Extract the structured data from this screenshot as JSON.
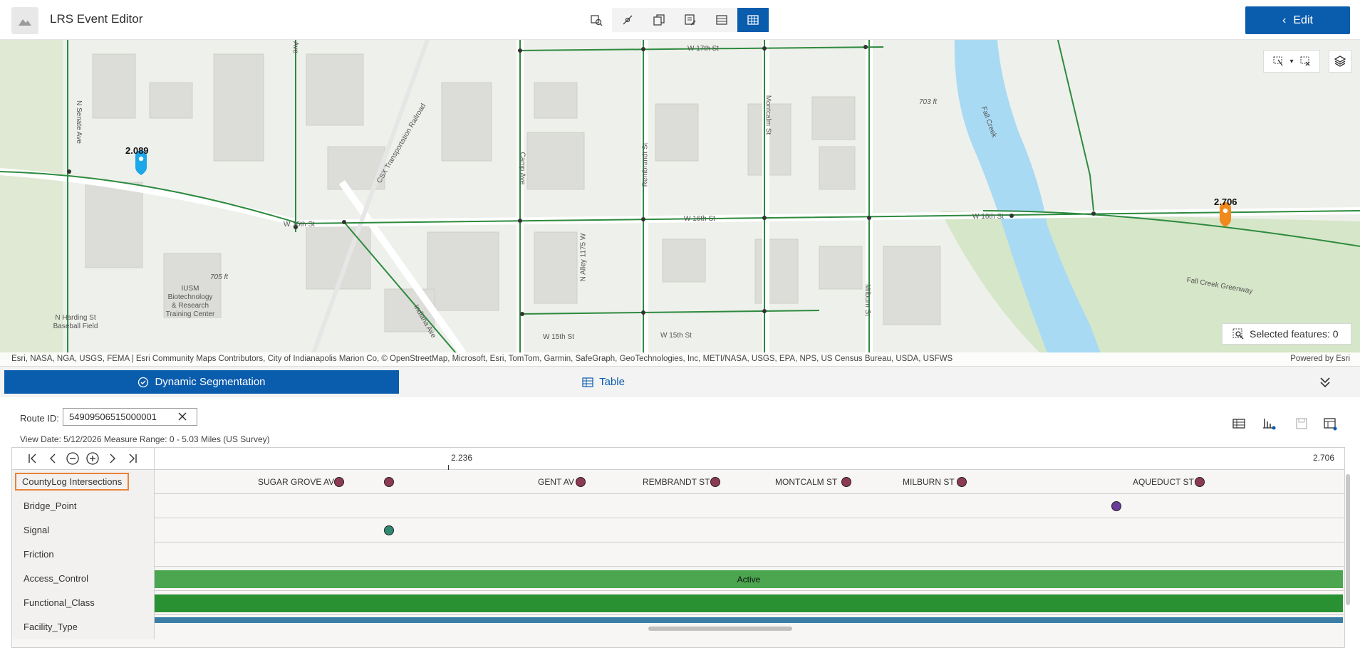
{
  "app": {
    "title": "LRS Event Editor",
    "edit_label": "Edit"
  },
  "toolbar": {
    "icons": [
      "identify-route-icon",
      "locate-measure-icon",
      "copy-events-icon",
      "edit-events-icon",
      "table-icon",
      "grid-table-icon"
    ],
    "active": "grid-table-icon"
  },
  "map": {
    "street_labels": [
      "W 17th St",
      "W 16th St",
      "W 16th St",
      "W 16th St",
      "W 15th St",
      "W 15th St",
      "Indiana Ave",
      "CSX Transportation Railroad",
      "N Senate Ave",
      "Camp Ave",
      "Rembrandt St",
      "N Alley 1175 W",
      "Montcalm St",
      "Milburn St",
      "Fall Creek",
      "Fall Creek Greenway",
      "Ave"
    ],
    "poi_labels": {
      "iusm": "IUSM Biotechnology & Research Training Center",
      "harding": "N Harding St Baseball Field",
      "elev1": "705 ft",
      "elev2": "703 ft"
    },
    "pins": [
      {
        "label": "2.089",
        "color": "#1ba7e8"
      },
      {
        "label": "2.706",
        "color": "#f08a1c"
      }
    ],
    "selected_features": "Selected features: 0",
    "attribution": "Esri, NASA, NGA, USGS, FEMA | Esri Community Maps Contributors, City of Indianapolis Marion Co, © OpenStreetMap, Microsoft, Esri, TomTom, Garmin, SafeGraph, GeoTechnologies, Inc, METI/NASA, USGS, EPA, NPS, US Census Bureau, USDA, USFWS",
    "powered_by": "Powered by Esri"
  },
  "tabs": {
    "dynamic_segmentation": "Dynamic Segmentation",
    "table": "Table"
  },
  "dynseg": {
    "route_label": "Route ID:",
    "route_value": "54909506515000001",
    "view_info": "View Date: 5/12/2026   Measure Range: 0 - 5.03 Miles (US Survey)",
    "ruler": {
      "left": "2.236",
      "right": "2.706"
    },
    "rows": [
      "CountyLog Intersections",
      "Bridge_Point",
      "Signal",
      "Friction",
      "Access_Control",
      "Functional_Class",
      "Facility_Type"
    ],
    "intersections": [
      "SUGAR GROVE AV",
      "GENT AV",
      "REMBRANDT ST",
      "MONTCALM ST",
      "MILBURN ST",
      "AQUEDUCT ST"
    ],
    "access_control_value": "Active",
    "colors": {
      "intersection": "#8e3a55",
      "bridge": "#6b3d9a",
      "signal": "#2e8a73",
      "access": "#4ba64f",
      "functional": "#2a9133",
      "facility": "#3a7ea6"
    }
  }
}
